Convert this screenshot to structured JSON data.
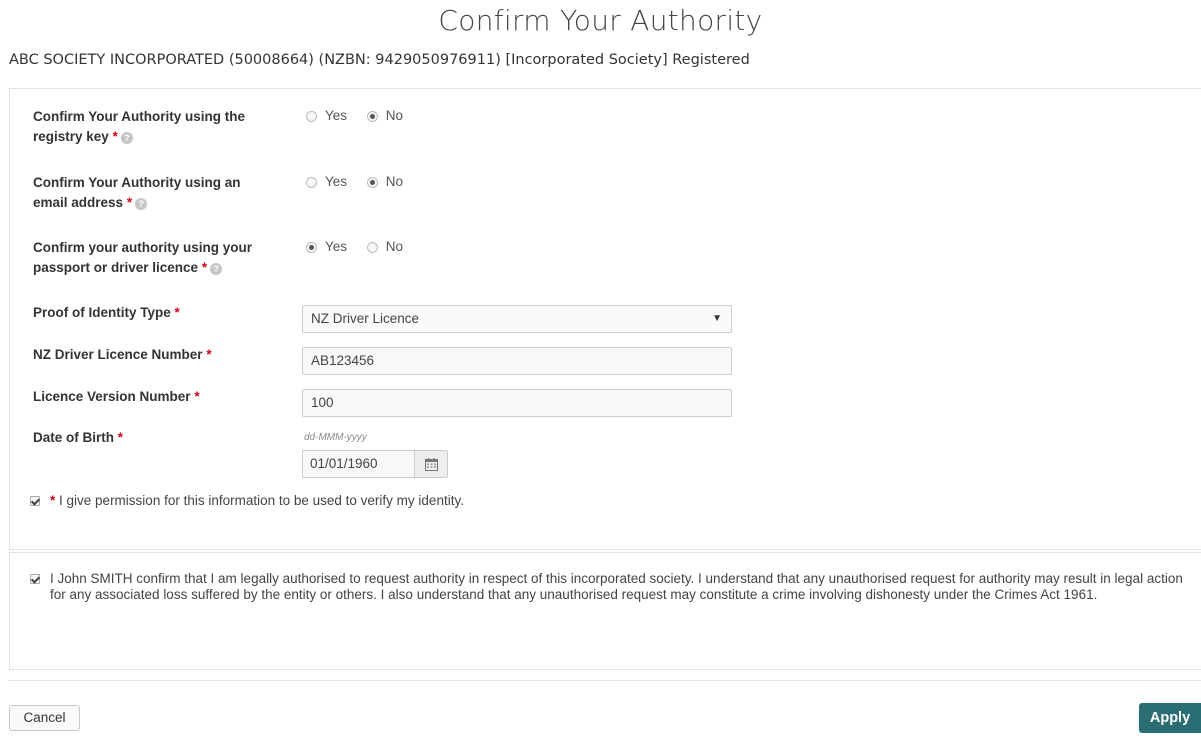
{
  "page": {
    "title": "Confirm Your Authority",
    "entity": "ABC SOCIETY INCORPORATED (50008664) (NZBN: 9429050976911) [Incorporated Society] Registered"
  },
  "form": {
    "required_marker": "*",
    "help_glyph": "?",
    "registry_key": {
      "label_line1": "Confirm Your Authority using the",
      "label_line2": "registry key",
      "options": [
        "Yes",
        "No"
      ],
      "selected": "No"
    },
    "email": {
      "label_line1": "Confirm Your Authority using an",
      "label_line2": "email address",
      "options": [
        "Yes",
        "No"
      ],
      "selected": "No"
    },
    "passport": {
      "label_line1": "Confirm your authority using your",
      "label_line2": "passport or driver licence",
      "options": [
        "Yes",
        "No"
      ],
      "selected": "Yes"
    },
    "proof_type": {
      "label": "Proof of Identity Type",
      "value": "NZ Driver Licence",
      "arrow": "▼"
    },
    "licence_number": {
      "label": "NZ Driver Licence Number",
      "value": "AB123456"
    },
    "licence_version": {
      "label": "Licence Version Number",
      "value": "100"
    },
    "dob": {
      "label": "Date of Birth",
      "hint": "dd-MMM-yyyy",
      "value": "01/01/1960"
    },
    "permission": {
      "checked": true,
      "text": "I give permission for this information to be used to verify my identity."
    }
  },
  "declaration": {
    "checked": true,
    "text": "I John SMITH confirm that I am legally authorised to request authority in respect of this incorporated society. I understand that any unauthorised request for authority may result in legal action for any associated loss suffered by the entity or others. I also understand that any unauthorised request may constitute a crime involving dishonesty under the Crimes Act 1961."
  },
  "actions": {
    "cancel": "Cancel",
    "apply": "Apply"
  },
  "colors": {
    "required": "#d0021b",
    "apply_bg": "#2a6e74"
  }
}
